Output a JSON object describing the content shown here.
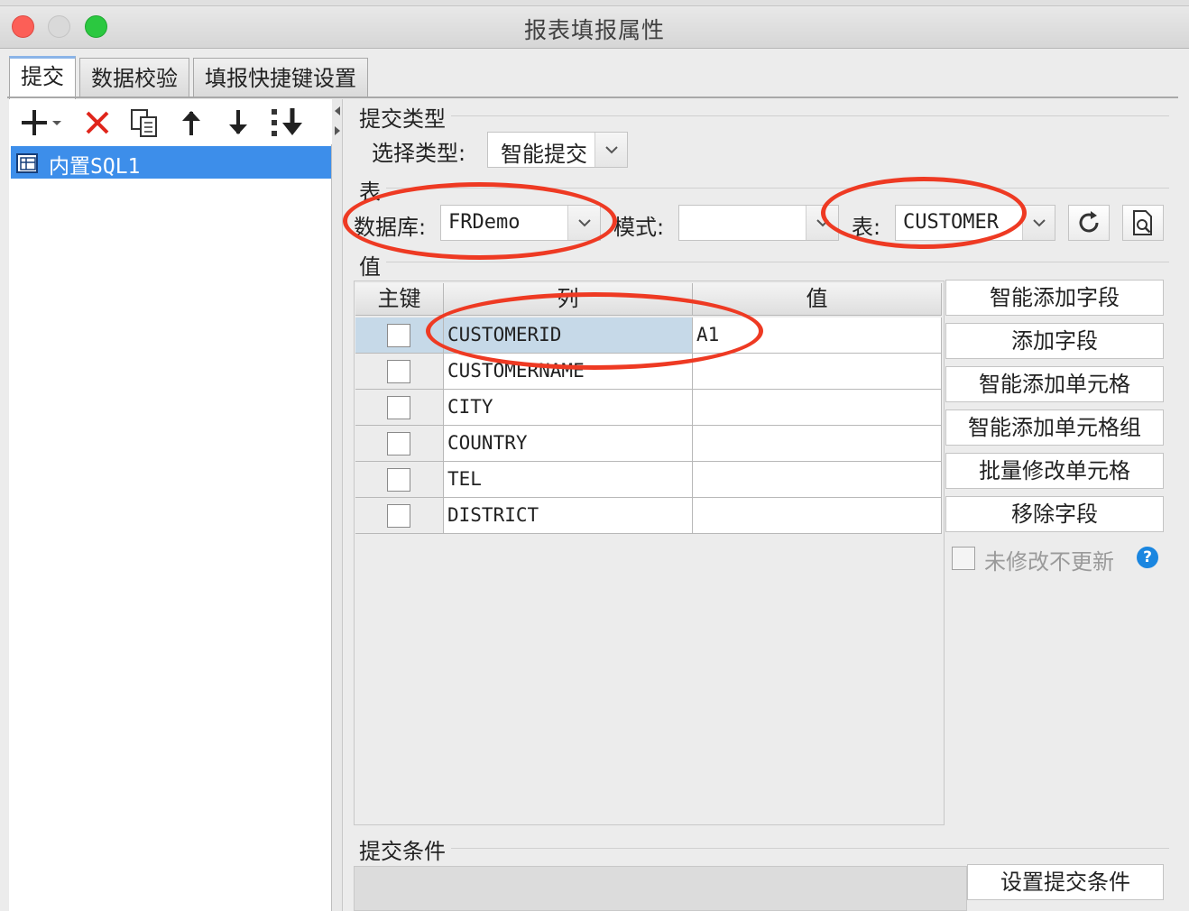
{
  "window": {
    "title": "报表填报属性"
  },
  "tabs": [
    {
      "label": "提交",
      "active": true
    },
    {
      "label": "数据校验",
      "active": false
    },
    {
      "label": "填报快捷键设置",
      "active": false
    }
  ],
  "left_panel": {
    "toolbar": [
      "add-icon",
      "delete-icon",
      "copy-icon",
      "move-up-icon",
      "move-down-icon",
      "move-bottom-icon"
    ],
    "tree": [
      {
        "label": "内置SQL1",
        "selected": true
      }
    ]
  },
  "submit_type": {
    "section": "提交类型",
    "label": "选择类型:",
    "value": "智能提交"
  },
  "table_section": {
    "section": "表",
    "database_label": "数据库:",
    "database_value": "FRDemo",
    "schema_label": "模式:",
    "schema_value": "",
    "table_label": "表:",
    "table_value": "CUSTOMER"
  },
  "value_section": {
    "section": "值",
    "headers": {
      "key": "主键",
      "column": "列",
      "value": "值"
    },
    "rows": [
      {
        "key": false,
        "column": "CUSTOMERID",
        "value": "A1",
        "selected": true
      },
      {
        "key": false,
        "column": "CUSTOMERNAME",
        "value": ""
      },
      {
        "key": false,
        "column": "CITY",
        "value": ""
      },
      {
        "key": false,
        "column": "COUNTRY",
        "value": ""
      },
      {
        "key": false,
        "column": "TEL",
        "value": ""
      },
      {
        "key": false,
        "column": "DISTRICT",
        "value": ""
      }
    ],
    "buttons": {
      "smart_add_field": "智能添加字段",
      "add_field": "添加字段",
      "smart_add_cell": "智能添加单元格",
      "smart_add_cell_group": "智能添加单元格组",
      "batch_modify_cell": "批量修改单元格",
      "remove_field": "移除字段"
    },
    "unmodified_no_update": {
      "label": "未修改不更新",
      "checked": false
    }
  },
  "submit_condition": {
    "section": "提交条件",
    "button": "设置提交条件"
  },
  "colors": {
    "selection": "#3d8eea",
    "annotation": "#ee3a23",
    "help": "#1a86e0"
  }
}
